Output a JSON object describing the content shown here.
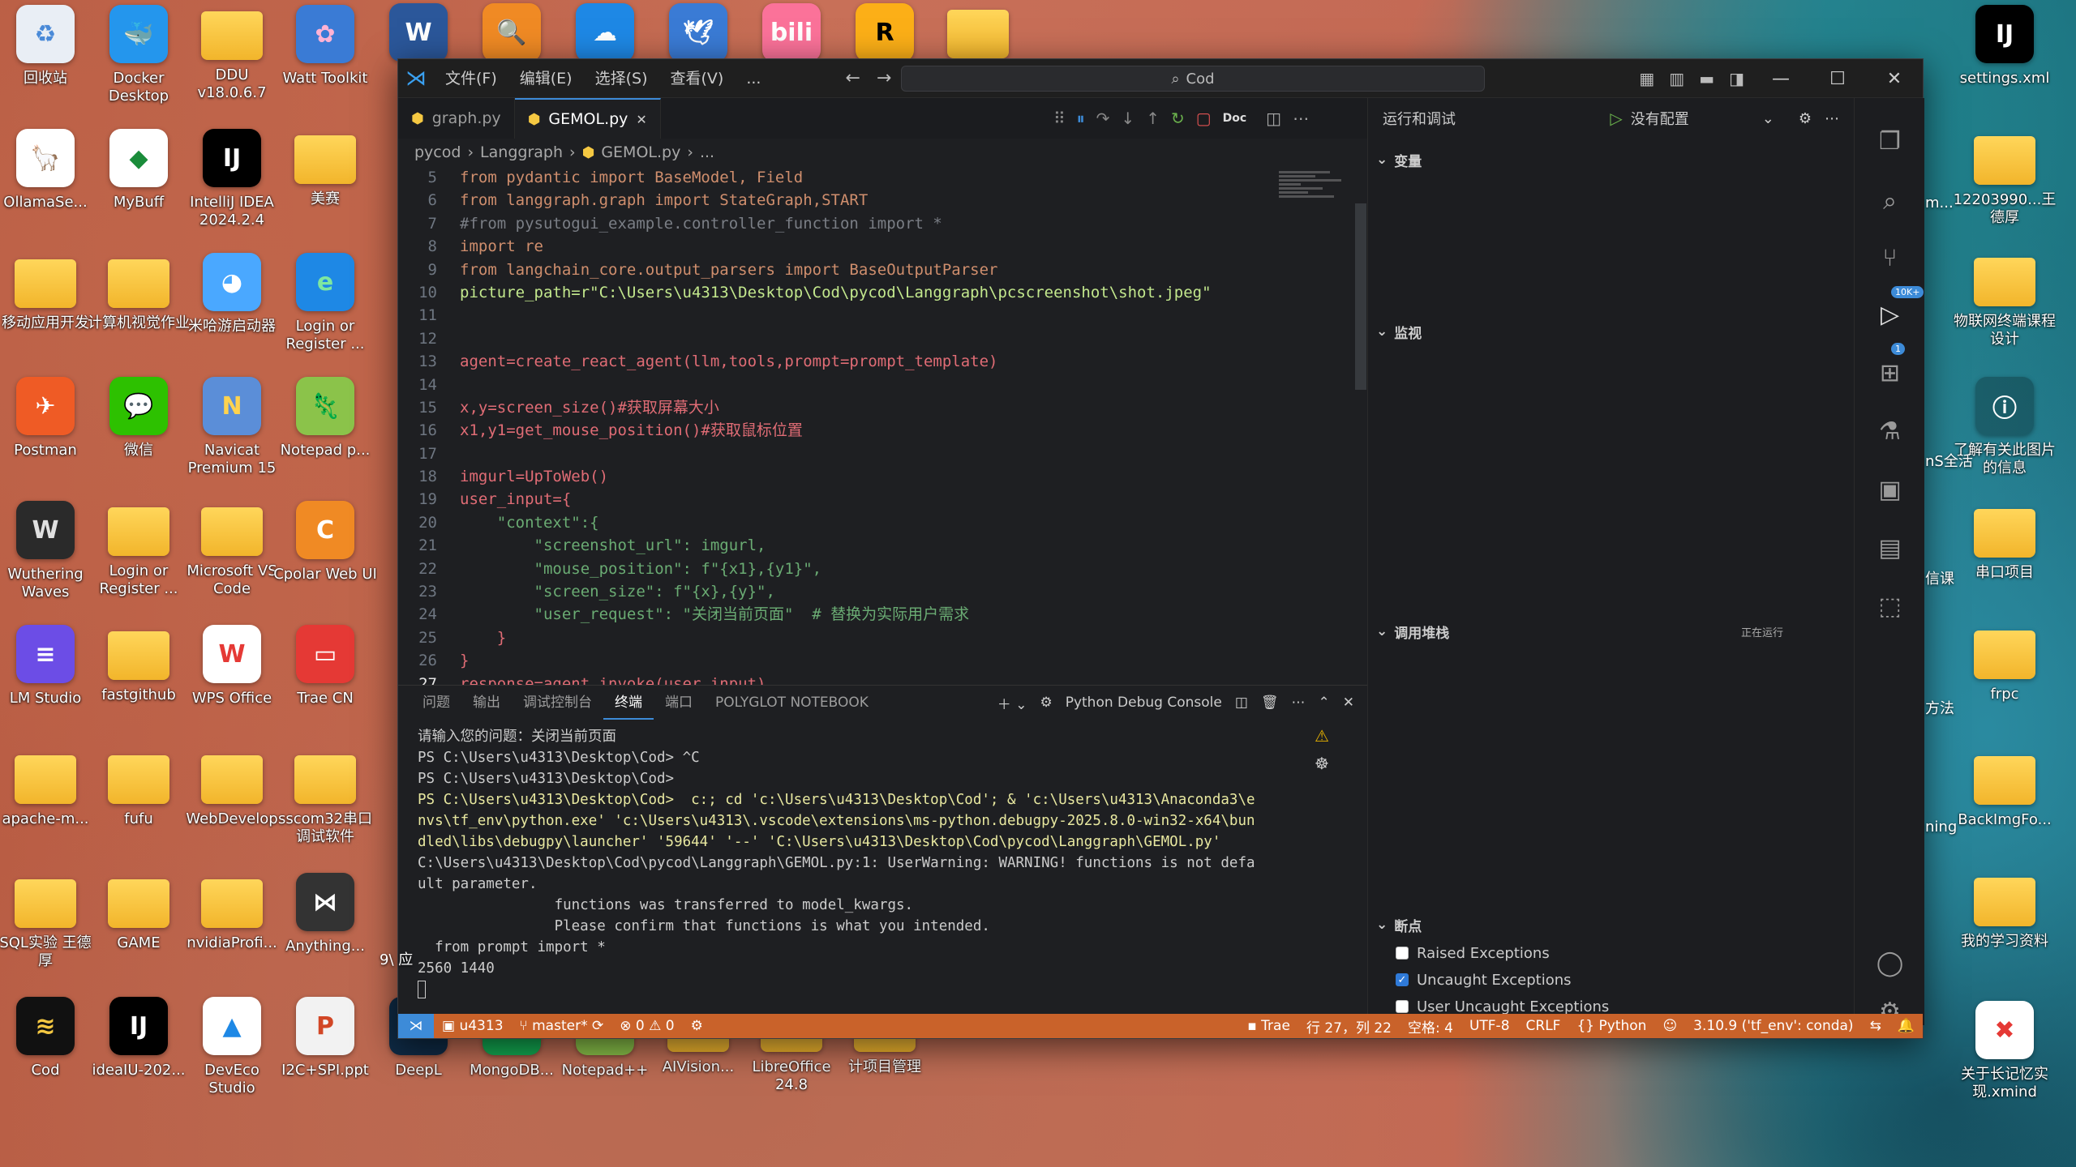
{
  "desktop": {
    "icons_left": [
      {
        "label": "回收站",
        "glyph": "♻",
        "color": "#e9eef5",
        "fg": "#4a8ad8",
        "kind": "app"
      },
      {
        "label": "Docker Desktop",
        "glyph": "🐳",
        "color": "#2496ed",
        "fg": "#ffffff",
        "kind": "app"
      },
      {
        "label": "DDU v18.0.6.7",
        "glyph": "",
        "color": "",
        "fg": "",
        "kind": "folder"
      },
      {
        "label": "Watt Toolkit",
        "glyph": "✿",
        "color": "#3a7bd5",
        "fg": "#ffb2d4",
        "kind": "app"
      },
      {
        "label": "OllamaSe...",
        "glyph": "🦙",
        "color": "#ffffff",
        "fg": "#000000",
        "kind": "app"
      },
      {
        "label": "MyBuff",
        "glyph": "◆",
        "color": "#ffffff",
        "fg": "#1a8c3a",
        "kind": "app"
      },
      {
        "label": "IntelliJ IDEA 2024.2.4",
        "glyph": "IJ",
        "color": "#000000",
        "fg": "#ffffff",
        "kind": "app"
      },
      {
        "label": "美赛",
        "glyph": "",
        "color": "",
        "fg": "",
        "kind": "folder"
      },
      {
        "label": "移动应用开发",
        "glyph": "",
        "color": "",
        "fg": "",
        "kind": "folder"
      },
      {
        "label": "计算机视觉作业",
        "glyph": "",
        "color": "",
        "fg": "",
        "kind": "folder"
      },
      {
        "label": "米哈游启动器",
        "glyph": "◕",
        "color": "#4aa8ff",
        "fg": "#ffffff",
        "kind": "app"
      },
      {
        "label": "Login or Register ...",
        "glyph": "e",
        "color": "#1e88e5",
        "fg": "#7ee7a0",
        "kind": "app"
      },
      {
        "label": "Postman",
        "glyph": "✈",
        "color": "#ef5b25",
        "fg": "#ffffff",
        "kind": "app"
      },
      {
        "label": "微信",
        "glyph": "💬",
        "color": "#2dc100",
        "fg": "#ffffff",
        "kind": "app"
      },
      {
        "label": "Navicat Premium 15",
        "glyph": "N",
        "color": "#5b8ed8",
        "fg": "#ffd34e",
        "kind": "app"
      },
      {
        "label": "Notepad p...",
        "glyph": "🦎",
        "color": "#8bc34a",
        "fg": "#ffffff",
        "kind": "app"
      },
      {
        "label": "Wuthering Waves",
        "glyph": "W",
        "color": "#2a2a2a",
        "fg": "#e0e0e0",
        "kind": "app"
      },
      {
        "label": "Login or Register ...",
        "glyph": "",
        "color": "",
        "fg": "",
        "kind": "folder"
      },
      {
        "label": "Microsoft VS Code",
        "glyph": "",
        "color": "",
        "fg": "",
        "kind": "folder"
      },
      {
        "label": "Cpolar Web UI",
        "glyph": "C",
        "color": "#f08a24",
        "fg": "#ffffff",
        "kind": "app"
      },
      {
        "label": "LM Studio",
        "glyph": "≡",
        "color": "#6c4de6",
        "fg": "#ffffff",
        "kind": "app"
      },
      {
        "label": "fastgithub",
        "glyph": "",
        "color": "",
        "fg": "",
        "kind": "folder"
      },
      {
        "label": "WPS Office",
        "glyph": "W",
        "color": "#ffffff",
        "fg": "#e53935",
        "kind": "app"
      },
      {
        "label": "Trae CN",
        "glyph": "▭",
        "color": "#e53935",
        "fg": "#ffffff",
        "kind": "app"
      },
      {
        "label": "apache-m...",
        "glyph": "",
        "color": "",
        "fg": "",
        "kind": "folder"
      },
      {
        "label": "fufu",
        "glyph": "",
        "color": "",
        "fg": "",
        "kind": "folder"
      },
      {
        "label": "WebDevelop",
        "glyph": "",
        "color": "",
        "fg": "",
        "kind": "folder"
      },
      {
        "label": "sscom32串口调试软件",
        "glyph": "",
        "color": "",
        "fg": "",
        "kind": "folder"
      },
      {
        "label": "SQL实验 王德厚",
        "glyph": "",
        "color": "",
        "fg": "",
        "kind": "folder"
      },
      {
        "label": "GAME",
        "glyph": "",
        "color": "",
        "fg": "",
        "kind": "folder"
      },
      {
        "label": "nvidiaProfi...",
        "glyph": "",
        "color": "",
        "fg": "",
        "kind": "folder"
      },
      {
        "label": "Anything...",
        "glyph": "⋈",
        "color": "#333333",
        "fg": "#ffffff",
        "kind": "app"
      },
      {
        "label": "Cod",
        "glyph": "≋",
        "color": "#111111",
        "fg": "#f5c842",
        "kind": "app"
      },
      {
        "label": "ideaIU-202...",
        "glyph": "IJ",
        "color": "#000000",
        "fg": "#ffffff",
        "kind": "app"
      },
      {
        "label": "DevEco Studio",
        "glyph": "▲",
        "color": "#ffffff",
        "fg": "#1e88e5",
        "kind": "app"
      },
      {
        "label": "I2C+SPI.ppt",
        "glyph": "P",
        "color": "#f2f2f2",
        "fg": "#d24726",
        "kind": "app"
      }
    ],
    "icons_taskbar_row": [
      {
        "label": "DeepL",
        "glyph": "D",
        "color": "#0f2b46",
        "fg": "#ffffff"
      },
      {
        "label": "MongoDB...",
        "glyph": "●",
        "color": "#13aa52",
        "fg": "#ffffff"
      },
      {
        "label": "Notepad++",
        "glyph": "✎",
        "color": "#8bc34a",
        "fg": "#ffffff"
      },
      {
        "label": "AIVision...",
        "glyph": "",
        "color": "",
        "fg": ""
      },
      {
        "label": "LibreOffice 24.8",
        "glyph": "",
        "color": "",
        "fg": ""
      },
      {
        "label": "计项目管理",
        "glyph": "",
        "color": "",
        "fg": ""
      }
    ],
    "icons_top_row": [
      {
        "label": "",
        "glyph": "W",
        "color": "#2b579a",
        "fg": "#ffffff"
      },
      {
        "label": "",
        "glyph": "🔍",
        "color": "#f08a24",
        "fg": "#ffffff"
      },
      {
        "label": "",
        "glyph": "☁",
        "color": "#1e88e5",
        "fg": "#ffffff"
      },
      {
        "label": "",
        "glyph": "🕊",
        "color": "#3a7bd5",
        "fg": "#ffffff"
      },
      {
        "label": "",
        "glyph": "bili",
        "color": "#fb7299",
        "fg": "#ffffff"
      },
      {
        "label": "",
        "glyph": "R",
        "color": "#fcaf17",
        "fg": "#000000"
      },
      {
        "label": "",
        "glyph": "",
        "color": "",
        "fg": ""
      }
    ],
    "icons_right": [
      {
        "label": "settings.xml",
        "glyph": "IJ",
        "color": "#000000",
        "fg": "#ffffff",
        "kind": "app"
      },
      {
        "label": "12203990...王德厚",
        "glyph": "",
        "color": "",
        "fg": "",
        "kind": "folder"
      },
      {
        "label": "物联网终端课程设计",
        "glyph": "",
        "color": "",
        "fg": "",
        "kind": "folder"
      },
      {
        "label": "了解有关此图片的信息",
        "glyph": "ⓘ",
        "color": "rgba(0,0,0,0.25)",
        "fg": "#ffffff",
        "kind": "app"
      },
      {
        "label": "串口项目",
        "glyph": "",
        "color": "",
        "fg": "",
        "kind": "folder"
      },
      {
        "label": "frpc",
        "glyph": "",
        "color": "",
        "fg": "",
        "kind": "folder"
      },
      {
        "label": "BackImgFo...",
        "glyph": "",
        "color": "",
        "fg": "",
        "kind": "folder"
      },
      {
        "label": "我的学习资料",
        "glyph": "",
        "color": "",
        "fg": "",
        "kind": "folder"
      },
      {
        "label": "关于长记忆实现.xmind",
        "glyph": "✖",
        "color": "#ffffff",
        "fg": "#e53935",
        "kind": "app"
      }
    ],
    "partial_labels": [
      "m...",
      "nS全活",
      "信课",
      "方法",
      "ning",
      "9\\ 应"
    ]
  },
  "window": {
    "menu": [
      "文件(F)",
      "编辑(E)",
      "选择(S)",
      "查看(V)",
      "..."
    ],
    "search_text": "Cod",
    "tabs": [
      {
        "label": "graph.py",
        "active": false
      },
      {
        "label": "GEMOL.py",
        "active": true
      }
    ],
    "tab_close": "✕",
    "breadcrumbs": [
      "pycod",
      "Langgraph",
      "GEMOL.py",
      "..."
    ],
    "doc_label": "Doc",
    "code_lines": [
      {
        "n": "5",
        "text": "from pydantic import BaseModel, Field"
      },
      {
        "n": "6",
        "text": "from langgraph.graph import StateGraph,START"
      },
      {
        "n": "7",
        "text": "#from pysutogui_example.controller_function import *"
      },
      {
        "n": "8",
        "text": "import re"
      },
      {
        "n": "9",
        "text": "from langchain_core.output_parsers import BaseOutputParser"
      },
      {
        "n": "10",
        "text": "picture_path=r\"C:\\Users\\u4313\\Desktop\\Cod\\pycod\\Langgraph\\pcscreenshot\\shot.jpeg\""
      },
      {
        "n": "11",
        "text": ""
      },
      {
        "n": "12",
        "text": ""
      },
      {
        "n": "13",
        "text": "agent=create_react_agent(llm,tools,prompt=prompt_template)"
      },
      {
        "n": "14",
        "text": ""
      },
      {
        "n": "15",
        "text": "x,y=screen_size()#获取屏幕大小"
      },
      {
        "n": "16",
        "text": "x1,y1=get_mouse_position()#获取鼠标位置"
      },
      {
        "n": "17",
        "text": ""
      },
      {
        "n": "18",
        "text": "imgurl=UpToWeb()"
      },
      {
        "n": "19",
        "text": "user_input={"
      },
      {
        "n": "20",
        "text": "    \"context\":{"
      },
      {
        "n": "21",
        "text": "        \"screenshot_url\": imgurl,"
      },
      {
        "n": "22",
        "text": "        \"mouse_position\": f\"{x1},{y1}\","
      },
      {
        "n": "23",
        "text": "        \"screen_size\": f\"{x},{y}\","
      },
      {
        "n": "24",
        "text": "        \"user_request\": \"关闭当前页面\"  # 替换为实际用户需求"
      },
      {
        "n": "25",
        "text": "    }"
      },
      {
        "n": "26",
        "text": "}"
      },
      {
        "n": "27",
        "text": "response=agent.invoke(user_input)"
      }
    ],
    "current_line": "27",
    "panel_tabs": [
      "问题",
      "输出",
      "调试控制台",
      "终端",
      "端口",
      "POLYGLOT NOTEBOOK"
    ],
    "panel_active_tab": "终端",
    "panel_terminal_name": "Python Debug Console",
    "terminal_lines": [
      "请输入您的问题：关闭当前页面",
      "PS C:\\Users\\u4313\\Desktop\\Cod> ^C",
      "PS C:\\Users\\u4313\\Desktop\\Cod>",
      "PS C:\\Users\\u4313\\Desktop\\Cod>  c:; cd 'c:\\Users\\u4313\\Desktop\\Cod'; & 'c:\\Users\\u4313\\Anaconda3\\e",
      "nvs\\tf_env\\python.exe' 'c:\\Users\\u4313\\.vscode\\extensions\\ms-python.debugpy-2025.8.0-win32-x64\\bun",
      "dled\\libs\\debugpy\\launcher' '59644' '--' 'C:\\Users\\u4313\\Desktop\\Cod\\pycod\\Langgraph\\GEMOL.py'",
      "C:\\Users\\u4313\\Desktop\\Cod\\pycod\\Langgraph\\GEMOL.py:1: UserWarning: WARNING! functions is not defa",
      "ult parameter.",
      "                functions was transferred to model_kwargs.",
      "                Please confirm that functions is what you intended.",
      "  from prompt import *",
      "2560 1440",
      ""
    ],
    "debug": {
      "title": "运行和调试",
      "config": "没有配置",
      "sections": {
        "variables": "变量",
        "watch": "监视",
        "callstack": "调用堆栈",
        "callstack_status": "正在运行",
        "breakpoints": "断点"
      },
      "breakpoints": [
        {
          "label": "Raised Exceptions",
          "checked": false
        },
        {
          "label": "Uncaught Exceptions",
          "checked": true
        },
        {
          "label": "User Uncaught Exceptions",
          "checked": false
        }
      ]
    },
    "activity_badges": {
      "scm": "10K+",
      "debug": "1"
    },
    "status": {
      "user": "u4313",
      "branch": "master*",
      "errors": "0",
      "warnings": "0",
      "trae": "Trae",
      "position": "行 27，列 22",
      "spaces": "空格: 4",
      "encoding": "UTF-8",
      "eol": "CRLF",
      "language": "Python",
      "interpreter": "3.10.9 ('tf_env': conda)"
    }
  }
}
